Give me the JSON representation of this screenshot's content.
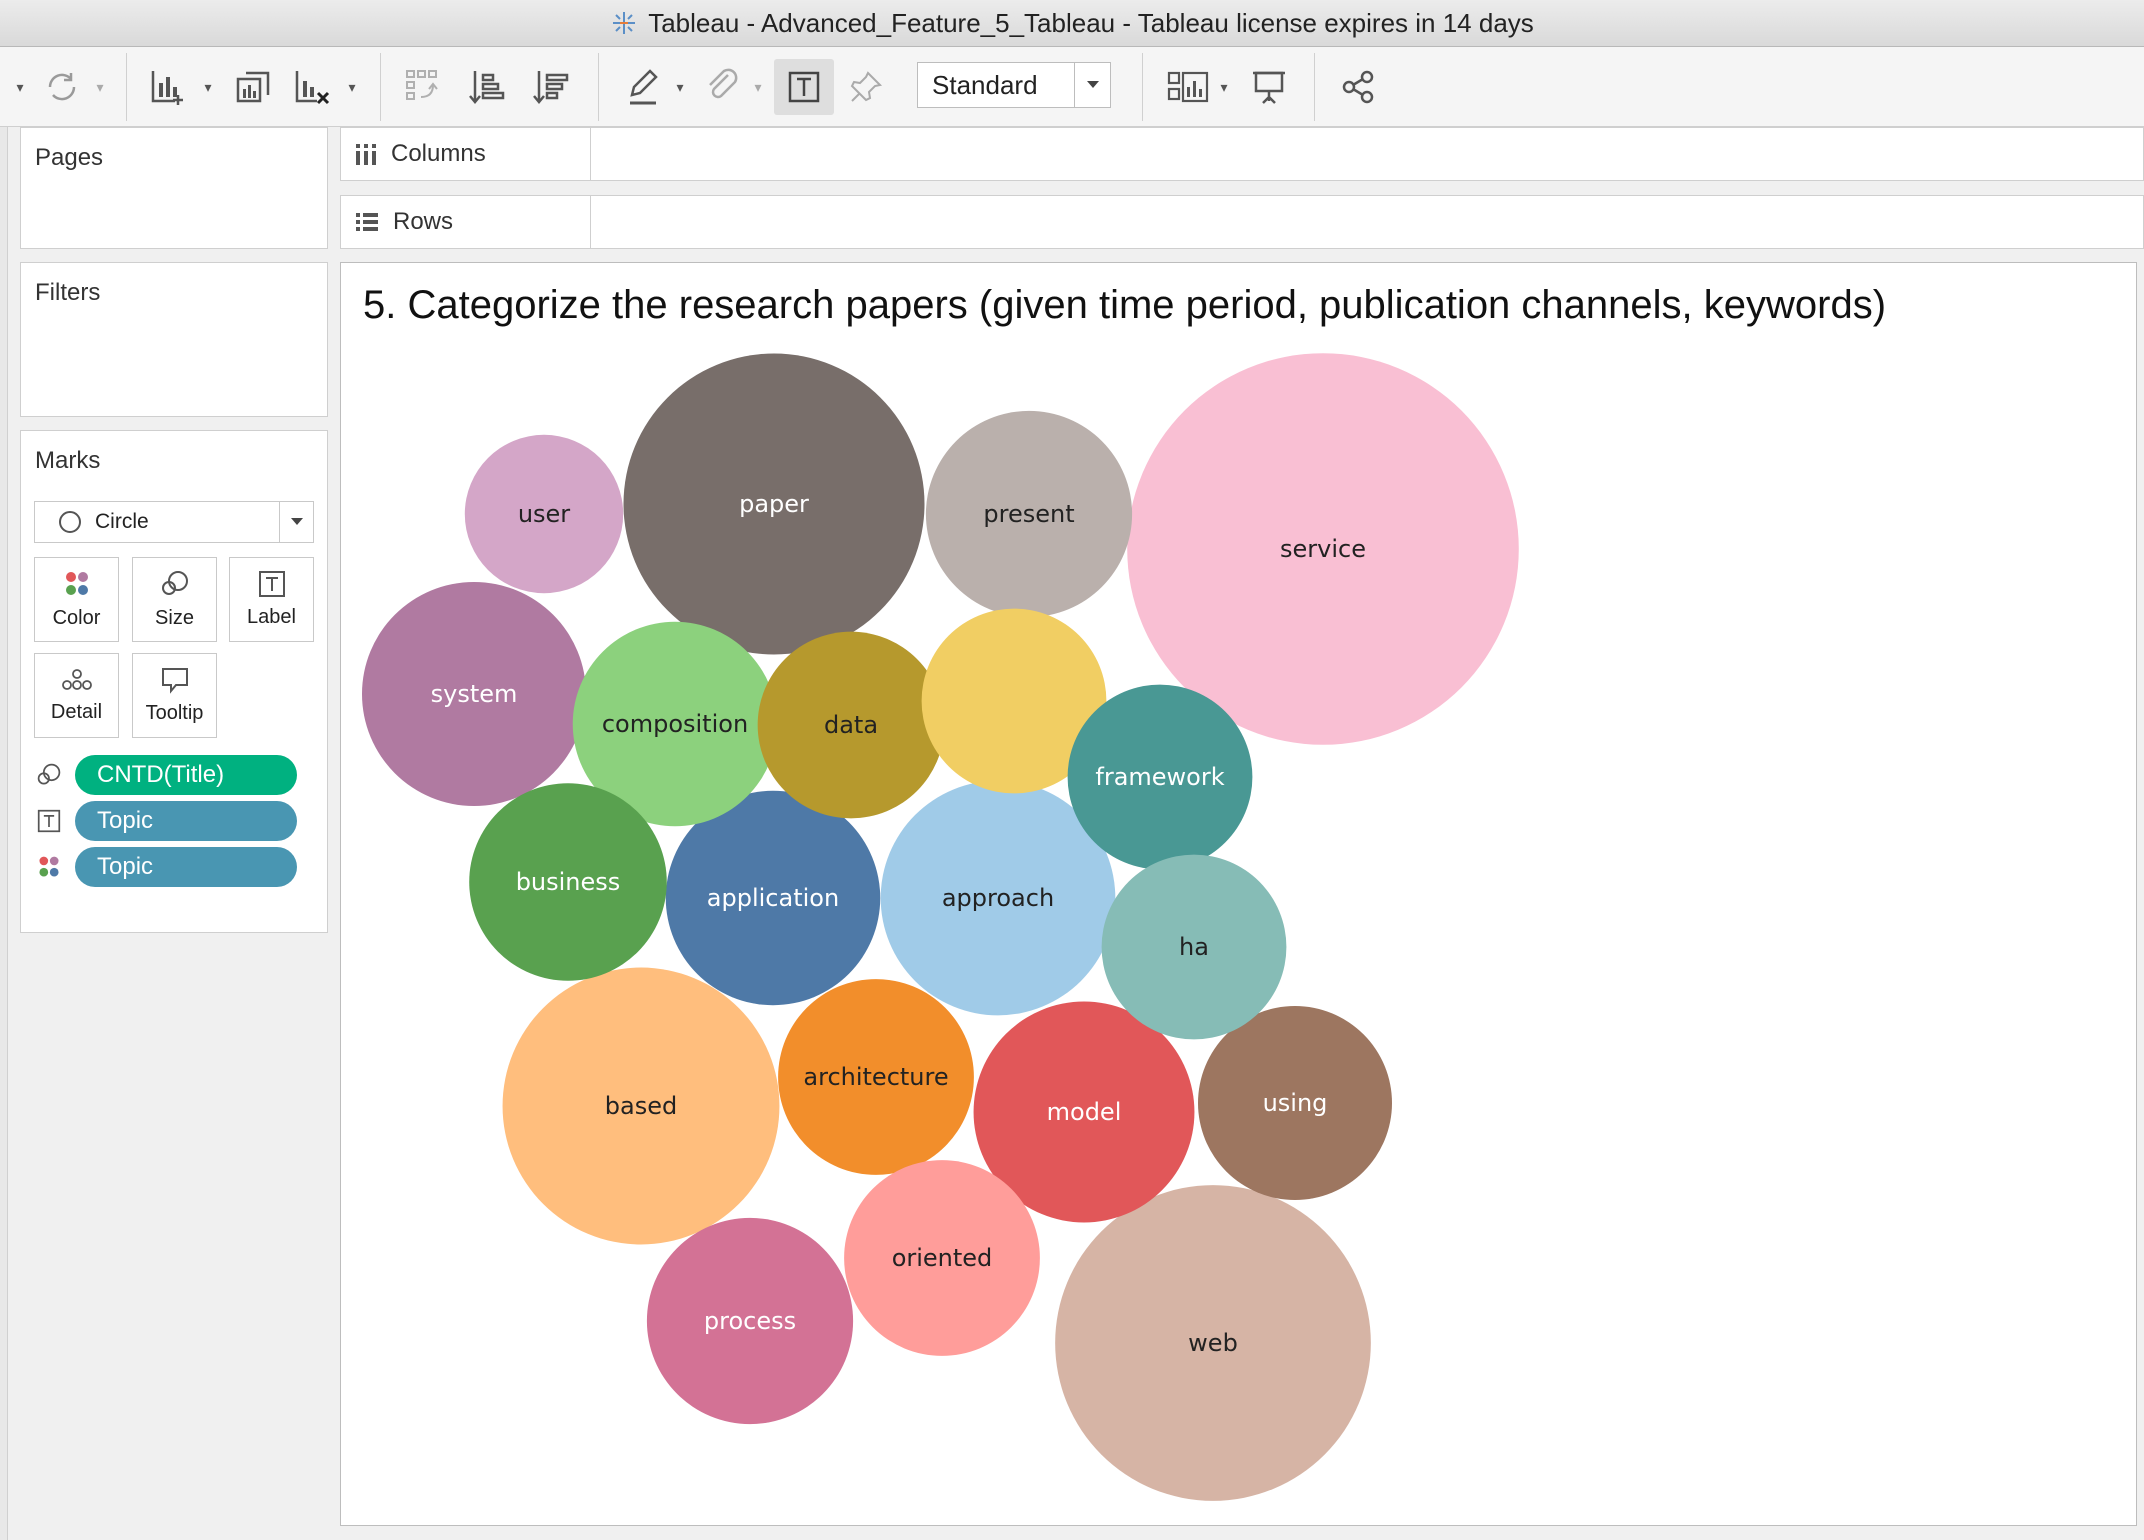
{
  "window": {
    "title": "Tableau - Advanced_Feature_5_Tableau - Tableau license expires in 14 days"
  },
  "toolbar": {
    "fit_select": "Standard",
    "icons": [
      "refresh-icon",
      "new-worksheet-icon",
      "duplicate-sheet-icon",
      "clear-sheet-icon",
      "swap-icon",
      "sort-ascending-icon",
      "sort-descending-icon",
      "highlight-icon",
      "group-icon",
      "show-labels-icon",
      "pin-icon",
      "show-me-icon",
      "presentation-icon",
      "share-icon"
    ]
  },
  "shelves": {
    "pages": "Pages",
    "filters": "Filters",
    "columns": "Columns",
    "rows": "Rows"
  },
  "marks": {
    "title": "Marks",
    "type": "Circle",
    "buttons": [
      "Color",
      "Size",
      "Label",
      "Detail",
      "Tooltip"
    ],
    "pills": [
      {
        "text": "CNTD(Title)",
        "encoding": "size",
        "color": "#00b180"
      },
      {
        "text": "Topic",
        "encoding": "label",
        "color": "#4996b2"
      },
      {
        "text": "Topic",
        "encoding": "color",
        "color": "#4996b2"
      }
    ]
  },
  "sheet": {
    "title": "5. Categorize the research papers (given time period, publication channels, keywords)"
  },
  "chart_data": {
    "type": "bubble",
    "size_field": "CNTD(Title)",
    "label_field": "Topic",
    "color_field": "Topic",
    "bubbles": [
      {
        "label": "service",
        "size": 2.2,
        "color": "#f9bfd3",
        "text_color": "#222222"
      },
      {
        "label": "web",
        "size": 1.43,
        "color": "#d6b4a5",
        "text_color": "#222222"
      },
      {
        "label": "paper",
        "size": 1.3,
        "color": "#786e6a",
        "text_color": "#ffffff"
      },
      {
        "label": "based",
        "size": 1.1,
        "color": "#ffbe7d",
        "text_color": "#222222"
      },
      {
        "label": "approach",
        "size": 0.79,
        "color": "#a0cbe8",
        "text_color": "#222222"
      },
      {
        "label": "system",
        "size": 0.72,
        "color": "#b07aa1",
        "text_color": "#ffffff"
      },
      {
        "label": "model",
        "size": 0.7,
        "color": "#e15759",
        "text_color": "#ffffff"
      },
      {
        "label": "application",
        "size": 0.66,
        "color": "#4e79a7",
        "text_color": "#ffffff"
      },
      {
        "label": "present",
        "size": 0.61,
        "color": "#bab0ac",
        "text_color": "#222222"
      },
      {
        "label": "process",
        "size": 0.61,
        "color": "#d37295",
        "text_color": "#ffffff"
      },
      {
        "label": "composition",
        "size": 0.6,
        "color": "#8cd17d",
        "text_color": "#222222"
      },
      {
        "label": "business",
        "size": 0.56,
        "color": "#59a14f",
        "text_color": "#ffffff"
      },
      {
        "label": "architecture",
        "size": 0.55,
        "color": "#f28e2b",
        "text_color": "#222222"
      },
      {
        "label": "oriented",
        "size": 0.55,
        "color": "#ff9d9a",
        "text_color": "#222222"
      },
      {
        "label": "using",
        "size": 0.54,
        "color": "#9d7660",
        "text_color": "#ffffff"
      },
      {
        "label": "data",
        "size": 0.5,
        "color": "#b6992d",
        "text_color": "#222222"
      },
      {
        "label": "",
        "size": 0.49,
        "color": "#f1ce63",
        "text_color": "#222222"
      },
      {
        "label": "framework",
        "size": 0.49,
        "color": "#499894",
        "text_color": "#ffffff"
      },
      {
        "label": "ha",
        "size": 0.49,
        "color": "#86bcb6",
        "text_color": "#222222"
      },
      {
        "label": "user",
        "size": 0.36,
        "color": "#d4a6c8",
        "text_color": "#222222"
      }
    ]
  }
}
